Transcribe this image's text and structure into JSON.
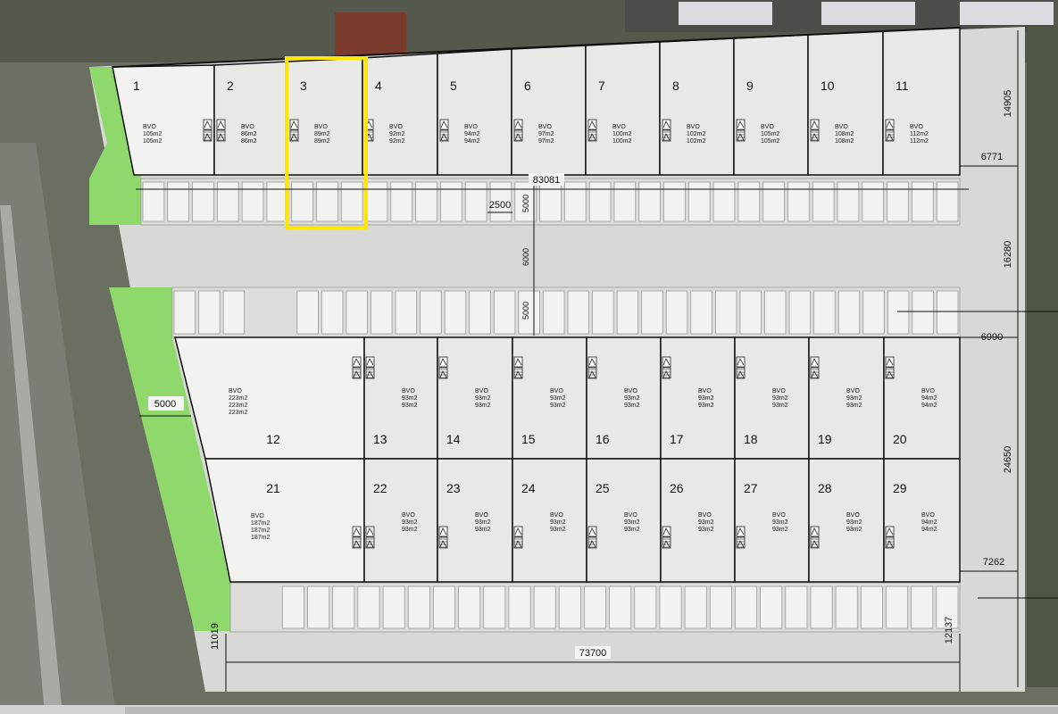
{
  "colors": {
    "unit_fill": "#e8e8e6",
    "large_unit_fill": "#f2f2f0",
    "paving": "#d9d9d7",
    "green": "#8fd86b",
    "highlight": "#ffe600",
    "outline": "#111111",
    "aerial_dark": "#5d6254"
  },
  "top_units": [
    {
      "num": "1",
      "bvo": "BVO",
      "area1": "105m2",
      "area2": "105m2"
    },
    {
      "num": "2",
      "bvo": "BVO",
      "area1": "86m2",
      "area2": "86m2"
    },
    {
      "num": "3",
      "bvo": "BVO",
      "area1": "89m2",
      "area2": "89m2"
    },
    {
      "num": "4",
      "bvo": "BVO",
      "area1": "92m2",
      "area2": "92m2"
    },
    {
      "num": "5",
      "bvo": "BVO",
      "area1": "94m2",
      "area2": "94m2"
    },
    {
      "num": "6",
      "bvo": "BVO",
      "area1": "97m2",
      "area2": "97m2"
    },
    {
      "num": "7",
      "bvo": "BVO",
      "area1": "100m2",
      "area2": "100m2"
    },
    {
      "num": "8",
      "bvo": "BVO",
      "area1": "102m2",
      "area2": "102m2"
    },
    {
      "num": "9",
      "bvo": "BVO",
      "area1": "105m2",
      "area2": "105m2"
    },
    {
      "num": "10",
      "bvo": "BVO",
      "area1": "108m2",
      "area2": "108m2"
    },
    {
      "num": "11",
      "bvo": "BVO",
      "area1": "112m2",
      "area2": "112m2"
    }
  ],
  "middle_units": [
    {
      "num": "12",
      "bvo": "BVO",
      "area1": "223m2",
      "area2": "223m2",
      "area3": "223m2"
    },
    {
      "num": "13",
      "bvo": "BVO",
      "area1": "93m2",
      "area2": "93m2"
    },
    {
      "num": "14",
      "bvo": "BVO",
      "area1": "93m2",
      "area2": "93m2"
    },
    {
      "num": "15",
      "bvo": "BVO",
      "area1": "93m2",
      "area2": "93m2"
    },
    {
      "num": "16",
      "bvo": "BVO",
      "area1": "93m2",
      "area2": "93m2"
    },
    {
      "num": "17",
      "bvo": "BVO",
      "area1": "93m2",
      "area2": "93m2"
    },
    {
      "num": "18",
      "bvo": "BVO",
      "area1": "93m2",
      "area2": "93m2"
    },
    {
      "num": "19",
      "bvo": "BVO",
      "area1": "93m2",
      "area2": "93m2"
    },
    {
      "num": "20",
      "bvo": "BVO",
      "area1": "94m2",
      "area2": "94m2"
    }
  ],
  "bottom_units": [
    {
      "num": "21",
      "bvo": "BVO",
      "area1": "187m2",
      "area2": "187m2",
      "area3": "187m2"
    },
    {
      "num": "22",
      "bvo": "BVO",
      "area1": "93m2",
      "area2": "93m2"
    },
    {
      "num": "23",
      "bvo": "BVO",
      "area1": "93m2",
      "area2": "93m2"
    },
    {
      "num": "24",
      "bvo": "BVO",
      "area1": "93m2",
      "area2": "93m2"
    },
    {
      "num": "25",
      "bvo": "BVO",
      "area1": "93m2",
      "area2": "93m2"
    },
    {
      "num": "26",
      "bvo": "BVO",
      "area1": "93m2",
      "area2": "93m2"
    },
    {
      "num": "27",
      "bvo": "BVO",
      "area1": "93m2",
      "area2": "93m2"
    },
    {
      "num": "28",
      "bvo": "BVO",
      "area1": "93m2",
      "area2": "93m2"
    },
    {
      "num": "29",
      "bvo": "BVO",
      "area1": "94m2",
      "area2": "94m2"
    }
  ],
  "dimensions": {
    "top_length": "83081",
    "bottom_length": "73700",
    "right_top": "14905",
    "right_mid": "16280",
    "right_low": "24650",
    "right_bottom": "12137",
    "depth_6771": "6771",
    "depth_6990": "6990",
    "depth_7262": "7262",
    "left_bottom": "11019",
    "green_width": "5000",
    "parking_width": "2500",
    "parking_depth_top": "5000",
    "road_width": "6000",
    "parking_depth_mid": "5000"
  },
  "highlighted_unit": "3"
}
